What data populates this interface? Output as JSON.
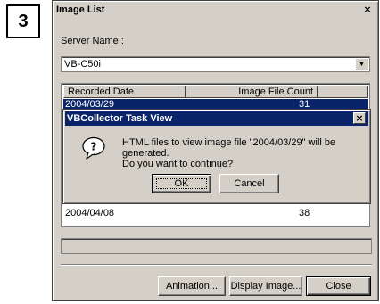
{
  "step_badge": "3",
  "main_window": {
    "title": "Image List",
    "close_glyph": "×",
    "server_name_label": "Server Name :",
    "server_combo": {
      "value": "VB-C50i",
      "arrow_icon": "▼"
    },
    "list": {
      "columns": [
        "Recorded Date",
        "Image File Count"
      ],
      "rows": [
        {
          "date": "2004/03/29",
          "count": "31",
          "selected": true
        },
        {
          "date": "2004/04/08",
          "count": "38",
          "selected": false
        }
      ]
    },
    "buttons": {
      "animation": "Animation...",
      "display_image": "Display Image...",
      "close": "Close"
    }
  },
  "dialog": {
    "title": "VBCollector Task View",
    "close_glyph": "×",
    "icon": "question-icon",
    "message_line1": "HTML files to view image file \"2004/03/29\" will be generated.",
    "message_line2": "Do you want to continue?",
    "ok_label": "OK",
    "cancel_label": "Cancel"
  }
}
